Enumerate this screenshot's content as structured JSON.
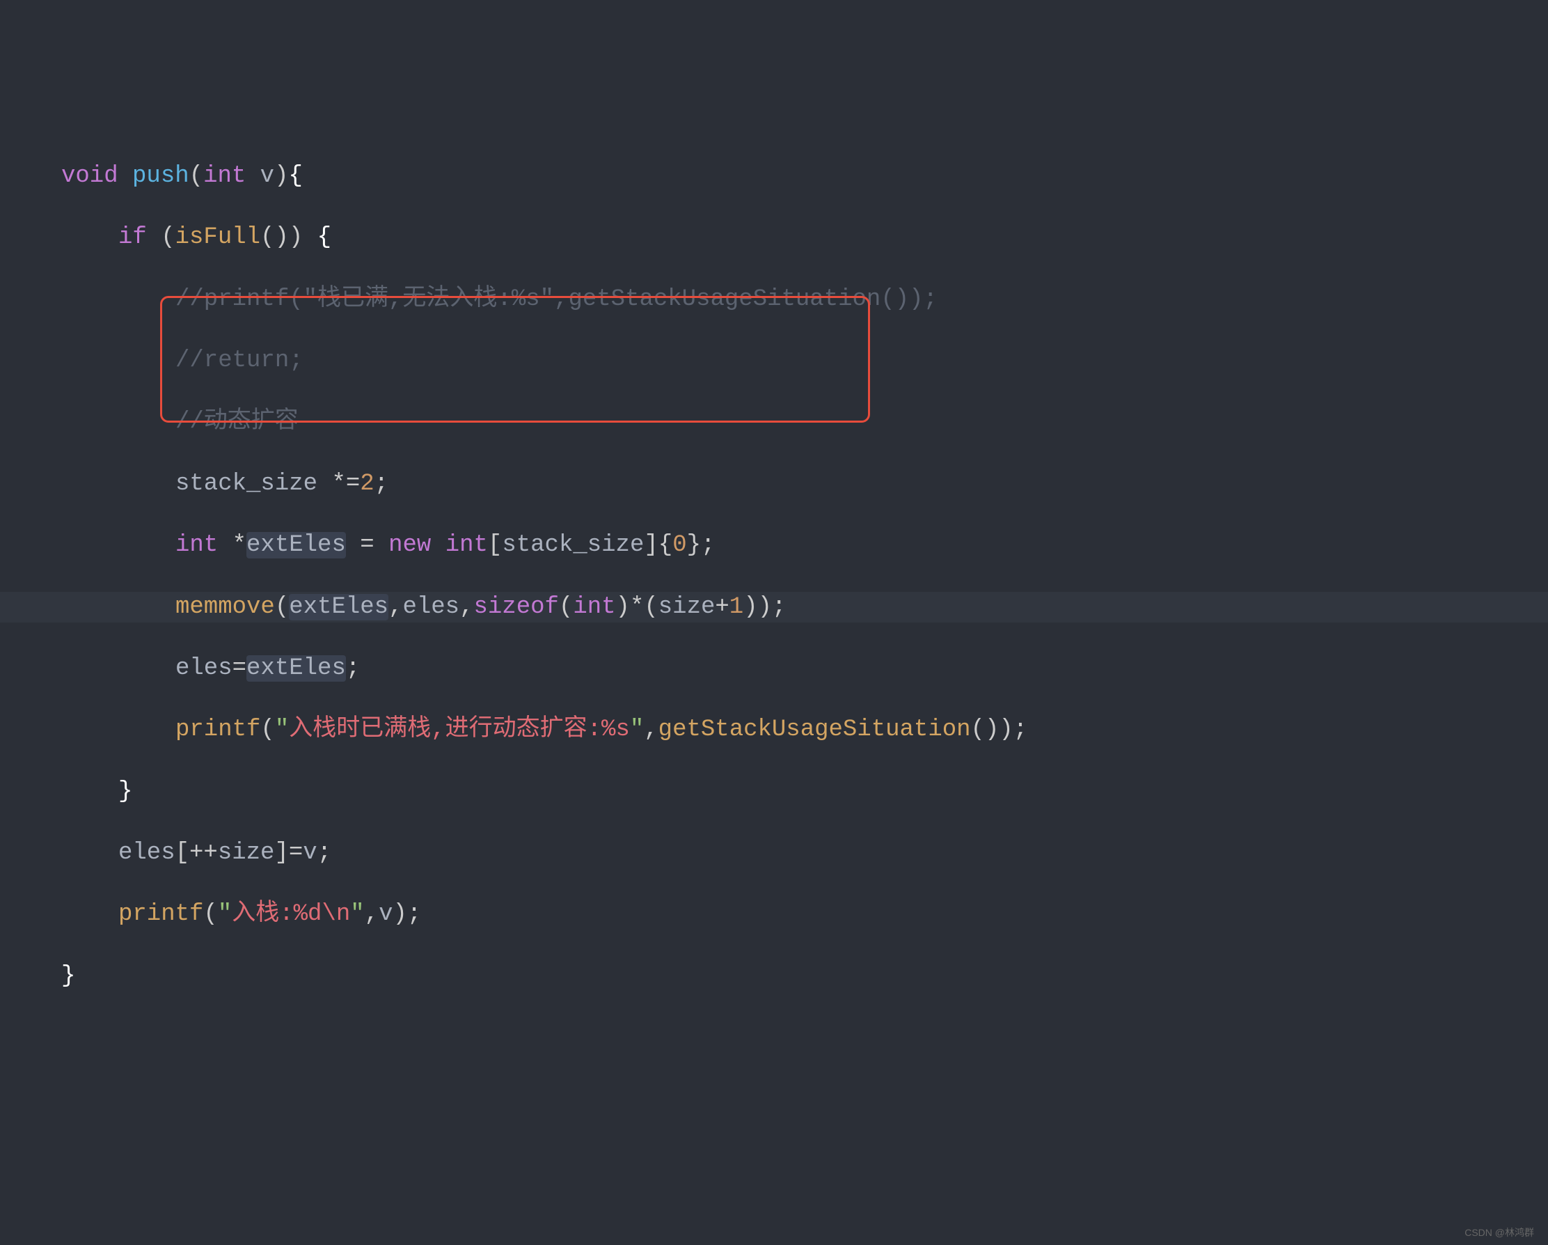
{
  "code": {
    "line1": {
      "void": "void",
      "fn": "push",
      "lparen": "(",
      "int": "int",
      "param": " v",
      "rparen": ")",
      "brace": "{"
    },
    "line2": {
      "if": "if",
      "lparen": " (",
      "fn": "isFull",
      "call": "()",
      "rparen": ") ",
      "brace": "{"
    },
    "line3": {
      "comment": "//printf(\"栈已满,无法入栈:%s\",getStackUsageSituation());"
    },
    "line4": {
      "comment": "//return;"
    },
    "line5": {
      "comment": "//动态扩容"
    },
    "line6": {
      "var": "stack_size ",
      "op": "*=",
      "num": "2",
      "semi": ";"
    },
    "line7": {
      "int": "int",
      "star": " *",
      "var": "extEles",
      "eq": " = ",
      "new": "new",
      "sp": " ",
      "int2": "int",
      "lbrack": "[",
      "var2": "stack_size",
      "rbrack": "]{",
      "num": "0",
      "end": "};"
    },
    "line8": {
      "fn": "memmove",
      "lparen": "(",
      "arg1": "extEles",
      "comma1": ",",
      "arg2": "eles",
      "comma2": ",",
      "sizeof": "sizeof",
      "lparen2": "(",
      "int": "int",
      "rparen2": ")*(",
      "size": "size",
      "plus": "+",
      "num": "1",
      "end": "));"
    },
    "line9": {
      "var1": "eles",
      "eq": "=",
      "var2": "extEles",
      "semi": ";"
    },
    "line10": {
      "fn": "printf",
      "lparen": "(",
      "quote1": "\"",
      "str": "入栈时已满栈,进行动态扩容:%s",
      "quote2": "\"",
      "comma": ",",
      "fn2": "getStackUsageSituation",
      "end": "());"
    },
    "line11": {
      "brace": "}"
    },
    "line12": {
      "var1": "eles",
      "lbrack": "[++",
      "var2": "size",
      "rbrack": "]=",
      "var3": "v",
      "semi": ";"
    },
    "line13": {
      "fn": "printf",
      "lparen": "(",
      "quote1": "\"",
      "str": "入栈:%d\\n",
      "quote2": "\"",
      "comma": ",",
      "var": "v",
      "end": ");"
    },
    "line14": {
      "brace": "}"
    }
  },
  "watermark": "CSDN @林鸿群"
}
